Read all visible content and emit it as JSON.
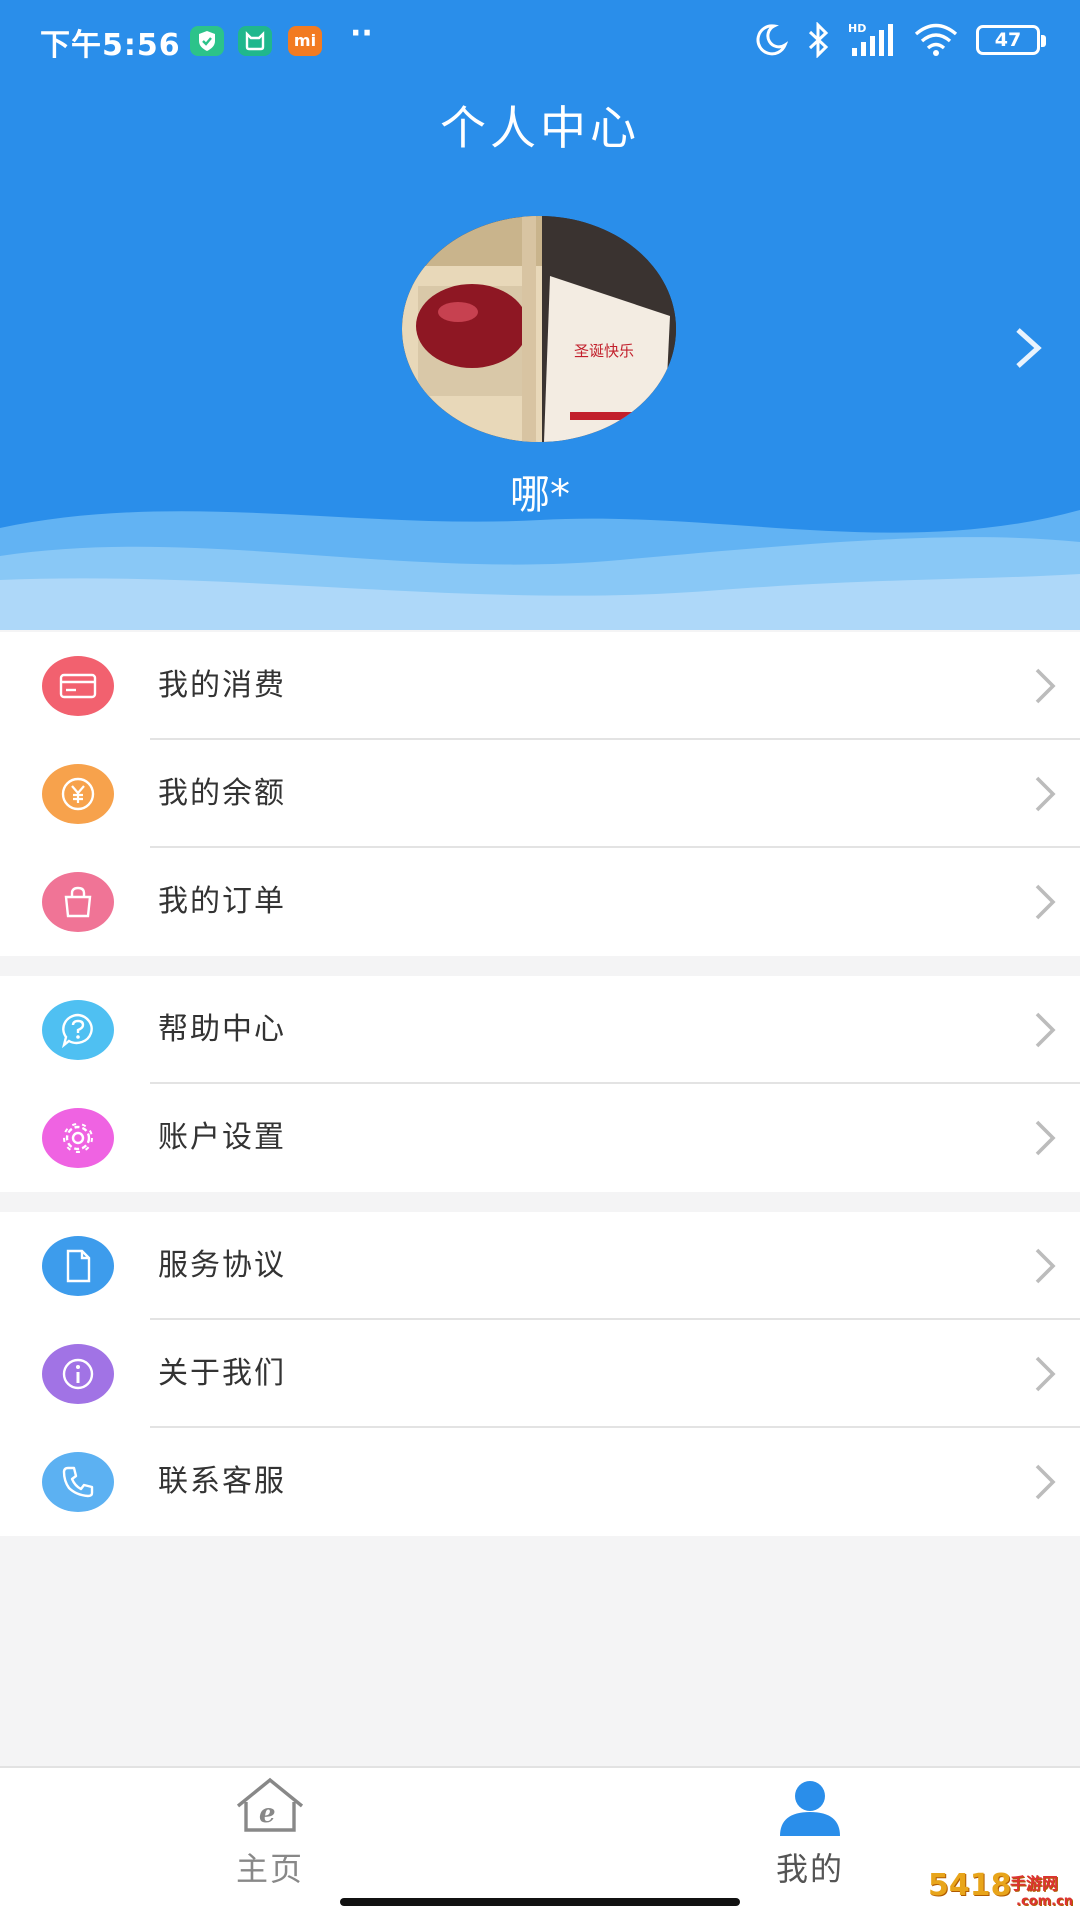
{
  "status_bar": {
    "time": "下午5:56",
    "battery": "47",
    "notif_icons": [
      "shield-icon",
      "cat-icon",
      "mi-icon"
    ],
    "mi_label": "mi"
  },
  "header": {
    "title": "个人中心"
  },
  "profile": {
    "name": "哪*"
  },
  "menu_groups": [
    {
      "items": [
        {
          "label": "我的消费",
          "icon": "card-icon",
          "color": "#f2616f"
        },
        {
          "label": "我的余额",
          "icon": "yuan-icon",
          "color": "#f7a24c"
        },
        {
          "label": "我的订单",
          "icon": "bag-icon",
          "color": "#f07496"
        }
      ]
    },
    {
      "items": [
        {
          "label": "帮助中心",
          "icon": "question-icon",
          "color": "#4fc0f2"
        },
        {
          "label": "账户设置",
          "icon": "gear-icon",
          "color": "#ef63e2"
        }
      ]
    },
    {
      "items": [
        {
          "label": "服务协议",
          "icon": "document-icon",
          "color": "#3d9cec"
        },
        {
          "label": "关于我们",
          "icon": "info-icon",
          "color": "#a173e5"
        },
        {
          "label": "联系客服",
          "icon": "phone-icon",
          "color": "#5cb1f2"
        }
      ]
    }
  ],
  "bottom_nav": {
    "home_label": "主页",
    "mine_label": "我的",
    "active": "mine",
    "active_color": "#2a8eea",
    "inactive_color": "#888888"
  },
  "watermark": {
    "text": "5418",
    "brand": "手游网",
    "domain": ".com.cn"
  }
}
